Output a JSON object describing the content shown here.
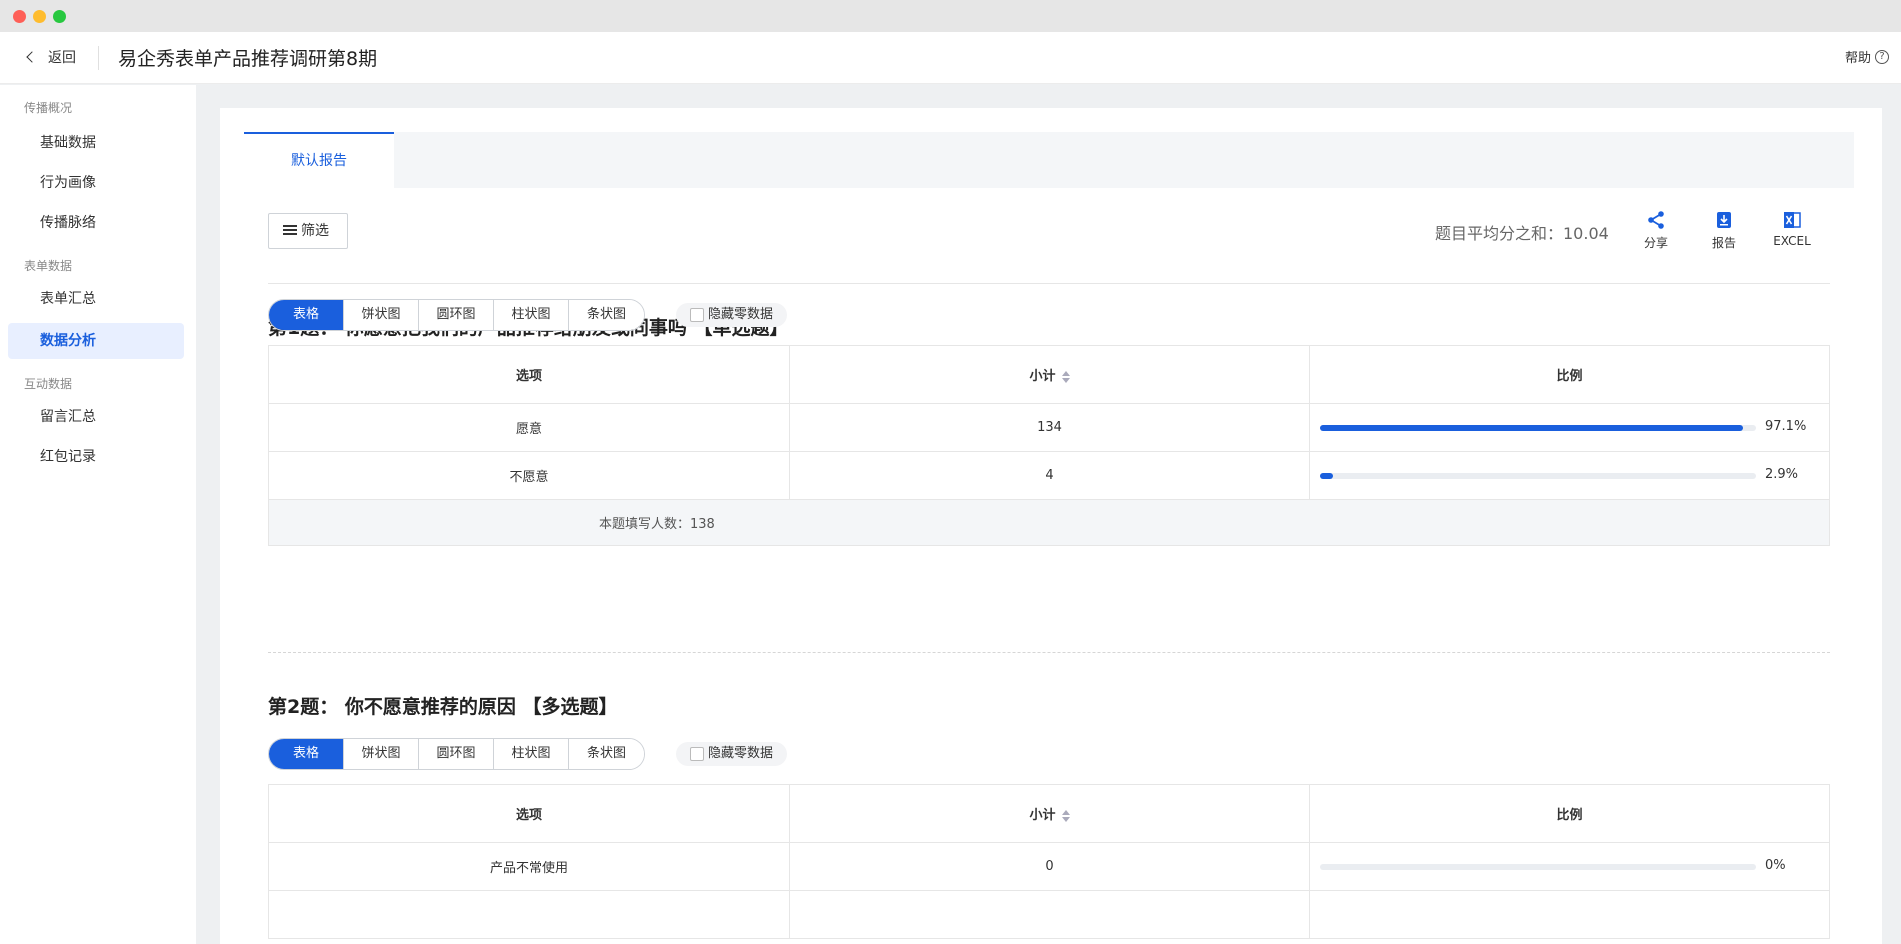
{
  "header": {
    "back_label": "返回",
    "title": "易企秀表单产品推荐调研第8期",
    "help_label": "帮助",
    "help_icon": "?"
  },
  "sidebar": {
    "groups": [
      {
        "label": "传播概况",
        "items": [
          "基础数据",
          "行为画像",
          "传播脉络"
        ]
      },
      {
        "label": "表单数据",
        "items": [
          "表单汇总",
          "数据分析"
        ]
      },
      {
        "label": "互动数据",
        "items": [
          "留言汇总",
          "红包记录"
        ]
      }
    ],
    "active": "数据分析"
  },
  "tabs": [
    {
      "label": "默认报告",
      "active": true
    }
  ],
  "toolbar": {
    "filter_label": "筛选",
    "avg_label": "题目平均分之和：10.04",
    "actions": [
      {
        "label": "分享",
        "icon": "share-icon"
      },
      {
        "label": "报告",
        "icon": "report-download-icon"
      },
      {
        "label": "EXCEL",
        "icon": "excel-icon"
      }
    ]
  },
  "view_modes": [
    "表格",
    "饼状图",
    "圆环图",
    "柱状图",
    "条状图"
  ],
  "hide_zero_label": "隐藏零数据",
  "table_headers": {
    "option": "选项",
    "count": "小计",
    "ratio": "比例"
  },
  "questions": [
    {
      "title": "第1题：  你愿意把我们的产品推荐给朋友或同事吗 【单选题】",
      "rows": [
        {
          "option": "愿意",
          "count": "134",
          "pct": "97.1%",
          "fill": 97.1
        },
        {
          "option": "不愿意",
          "count": "4",
          "pct": "2.9%",
          "fill": 2.9
        }
      ],
      "summary": "本题填写人数：138"
    },
    {
      "title": "第2题：  你不愿意推荐的原因 【多选题】",
      "rows": [
        {
          "option": "产品不常使用",
          "count": "0",
          "pct": "0%",
          "fill": 0
        }
      ]
    }
  ],
  "colors": {
    "accent": "#1a5fdd",
    "track": "#eaedf1"
  }
}
